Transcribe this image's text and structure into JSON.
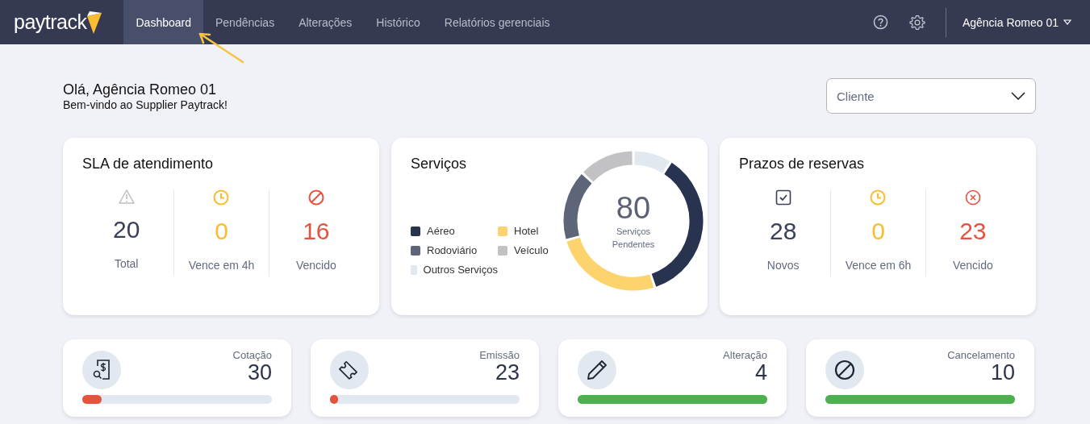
{
  "header": {
    "logo": "paytrack",
    "tabs": [
      {
        "label": "Dashboard",
        "selected": true
      },
      {
        "label": "Pendências",
        "selected": false
      },
      {
        "label": "Alterações",
        "selected": false
      },
      {
        "label": "Histórico",
        "selected": false
      },
      {
        "label": "Relatórios gerenciais",
        "selected": false
      }
    ],
    "user": "Agência Romeo 01"
  },
  "greeting": {
    "title": "Olá, Agência Romeo 01",
    "subtitle": "Bem-vindo ao Supplier Paytrack!"
  },
  "client_select": {
    "placeholder": "Cliente"
  },
  "sla": {
    "title": "SLA de atendimento",
    "stats": [
      {
        "kind": "warning",
        "value": "20",
        "label": "Total",
        "color": "#3b4158"
      },
      {
        "kind": "clock",
        "value": "0",
        "label": "Vence em 4h",
        "color": "#fbbd2e"
      },
      {
        "kind": "ban",
        "value": "16",
        "label": "Vencido",
        "color": "#e5533f"
      }
    ]
  },
  "services": {
    "title": "Serviços",
    "total": "80",
    "total_label": "Serviços Pendentes",
    "legend": [
      {
        "label": "Aéreo",
        "color": "#283350"
      },
      {
        "label": "Hotel",
        "color": "#fdd36e"
      },
      {
        "label": "Rodoviário",
        "color": "#5f6578"
      },
      {
        "label": "Veículo",
        "color": "#c2c2c4"
      },
      {
        "label": "Outros Serviços",
        "color": "#e1e8ef"
      }
    ]
  },
  "deadlines": {
    "title": "Prazos de reservas",
    "stats": [
      {
        "kind": "check",
        "value": "28",
        "label": "Novos",
        "color": "#3b4158"
      },
      {
        "kind": "clock",
        "value": "0",
        "label": "Vence em 6h",
        "color": "#fbbd2e"
      },
      {
        "kind": "cross",
        "value": "23",
        "label": "Vencido",
        "color": "#e5533f"
      }
    ]
  },
  "counters": [
    {
      "kind": "quote",
      "label": "Cotação",
      "value": "30",
      "level": 0.1,
      "color": "#e5533f"
    },
    {
      "kind": "ticket",
      "label": "Emissão",
      "value": "23",
      "level": 0.03,
      "color": "#e5533f"
    },
    {
      "kind": "pencil",
      "label": "Alteração",
      "value": "4",
      "level": 1,
      "color": "#4caf50"
    },
    {
      "kind": "ban",
      "label": "Cancelamento",
      "value": "10",
      "level": 1,
      "color": "#4caf50"
    }
  ]
}
